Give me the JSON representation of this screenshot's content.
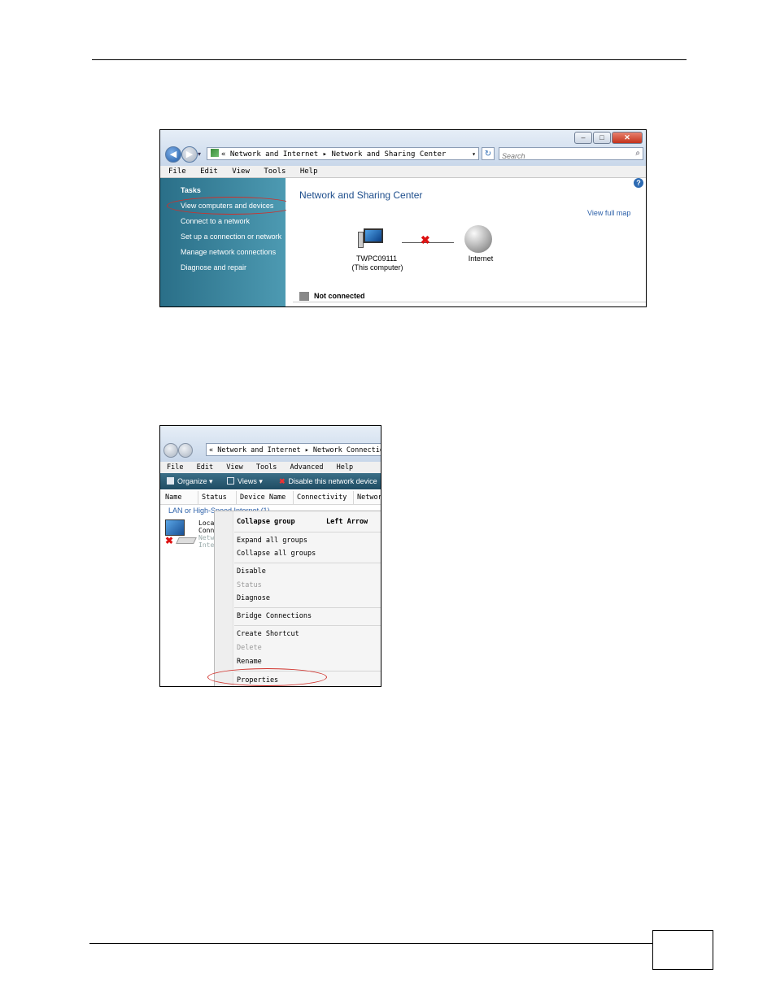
{
  "window1": {
    "address_path": "« Network and Internet ▸ Network and Sharing Center",
    "search_placeholder": "Search",
    "menu": [
      "File",
      "Edit",
      "View",
      "Tools",
      "Help"
    ],
    "tasks_heading": "Tasks",
    "tasks": [
      "View computers and devices",
      "Connect to a network",
      "Set up a connection or network",
      "Manage network connections",
      "Diagnose and repair"
    ],
    "title": "Network and Sharing Center",
    "view_full_map": "View full map",
    "computer_name": "TWPC09111",
    "computer_sub": "(This computer)",
    "internet_label": "Internet",
    "status": "Not connected"
  },
  "window2": {
    "address_path": "« Network and Internet ▸ Network Connections",
    "menu": [
      "File",
      "Edit",
      "View",
      "Tools",
      "Advanced",
      "Help"
    ],
    "toolbar": {
      "organize": "Organize ▾",
      "views": "Views ▾",
      "disable": "Disable this network device"
    },
    "columns": [
      "Name",
      "Status",
      "Device Name",
      "Connectivity",
      "Network"
    ],
    "group_label": "LAN or High-Speed Internet (1)",
    "connection_lines": [
      "Local",
      "Conne",
      "Netw",
      "Intel"
    ],
    "context_menu": {
      "collapse_group": "Collapse group",
      "shortcut": "Left Arrow",
      "expand_all": "Expand all groups",
      "collapse_all": "Collapse all groups",
      "disable": "Disable",
      "status": "Status",
      "diagnose": "Diagnose",
      "bridge": "Bridge Connections",
      "create_shortcut": "Create Shortcut",
      "delete": "Delete",
      "rename": "Rename",
      "properties": "Properties"
    }
  }
}
